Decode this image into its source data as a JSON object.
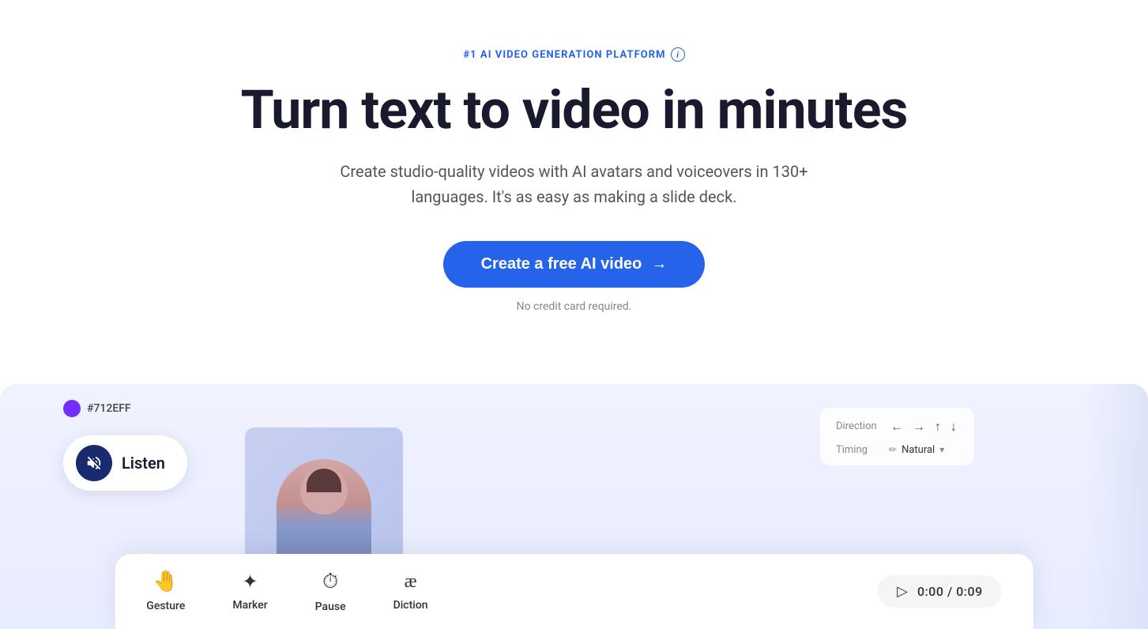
{
  "hero": {
    "badge_text": "#1 AI VIDEO GENERATION PLATFORM",
    "badge_info": "i",
    "title": "Turn text to video in minutes",
    "subtitle": "Create studio-quality videos with AI avatars and voiceovers in 130+ languages. It's as easy as making a slide deck.",
    "cta_label": "Create a free AI video",
    "cta_arrow": "→",
    "no_credit_card": "No credit card required."
  },
  "preview": {
    "color_swatch": "#712EFF",
    "color_hex_label": "#712EFF",
    "listen_label": "Listen",
    "listen_icon": "🔇",
    "direction_label": "Direction",
    "timing_label": "Timing",
    "timing_value": "Natural",
    "timing_pencil": "✏",
    "dir_arrows": [
      "←",
      "→",
      "↑",
      "↓"
    ],
    "tools": [
      {
        "icon": "👋",
        "label": "Gesture"
      },
      {
        "icon": "✦",
        "label": "Marker"
      },
      {
        "icon": "⏱",
        "label": "Pause"
      },
      {
        "icon": "æ",
        "label": "Diction"
      }
    ],
    "time_current": "0:00",
    "time_total": "0:09",
    "time_display": "0:00 / 0:09"
  }
}
